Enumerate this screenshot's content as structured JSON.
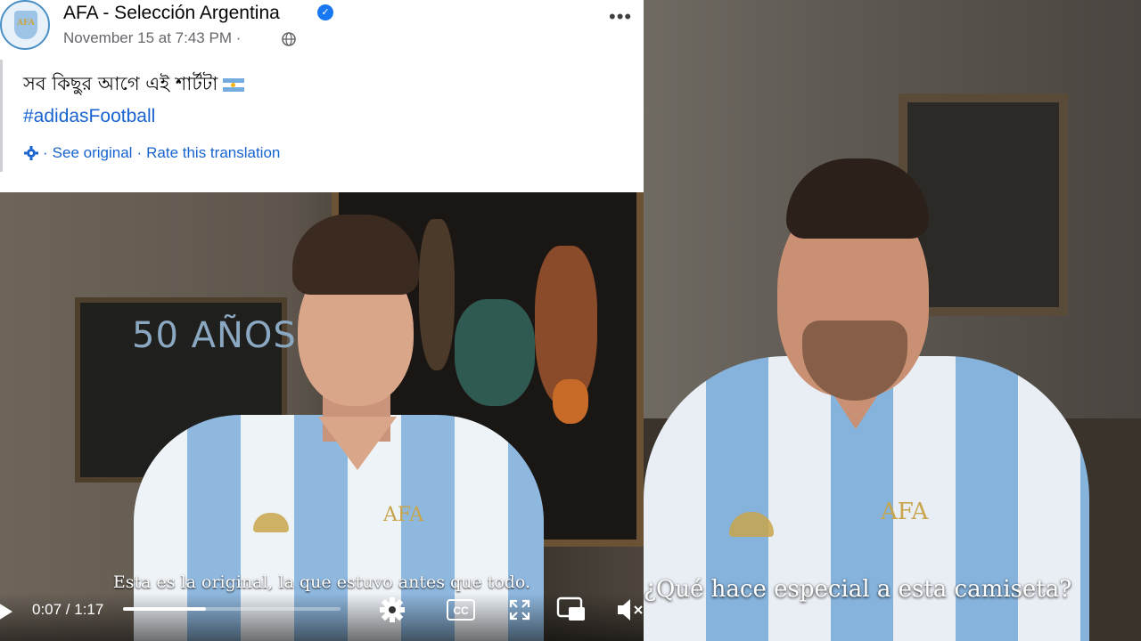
{
  "post": {
    "page_name": "AFA - Selección Argentina",
    "timestamp": "November 15 at 7:43 PM",
    "separator": "·",
    "text": "সব কিছুর আগে এই শার্টটা",
    "hashtag": "#adidasFootball",
    "translation": {
      "separator": "·",
      "see_original": "See original",
      "rate": "Rate this translation"
    },
    "more_label": "•••",
    "avatar_text": "AFA"
  },
  "video_left": {
    "subtitle": "Esta es la original, la que estuvo antes que todo.",
    "time": "0:07 / 1:17",
    "progress": 0.38,
    "chalkboard_text": "50 AÑOS"
  },
  "video_right": {
    "subtitle": "¿Qué hace especial a esta camiseta?"
  },
  "icons": {
    "verified": "verified-icon",
    "globe": "globe-icon",
    "settings": "gear-icon",
    "captions": "cc-icon",
    "fullscreen": "expand-icon",
    "pip": "picture-in-picture-icon",
    "volume": "mute-icon"
  },
  "colors": {
    "link": "#1763cf",
    "verified": "#1877f2",
    "secondary_text": "#65676b"
  }
}
